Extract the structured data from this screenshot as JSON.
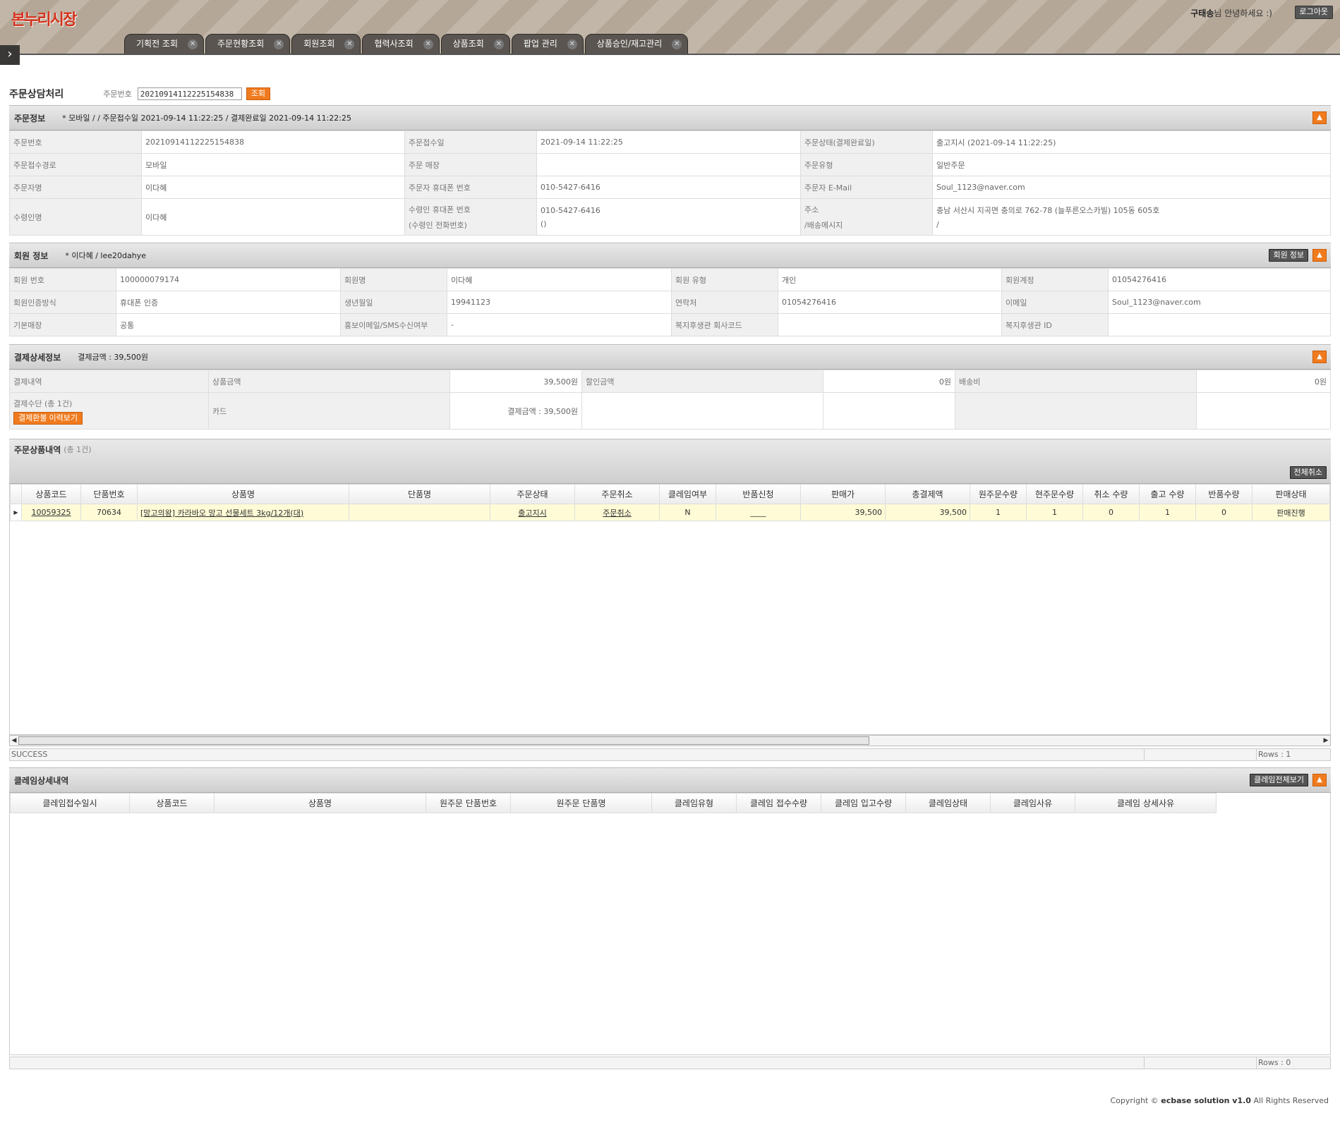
{
  "header": {
    "logo": "본누리시장",
    "user": "구태송",
    "greet_suffix": "님 안녕하세요 :)",
    "logout": "로그아웃"
  },
  "tabs": [
    {
      "label": "기획전 조회"
    },
    {
      "label": "주문현황조회"
    },
    {
      "label": "회원조회"
    },
    {
      "label": "협력사조회"
    },
    {
      "label": "상품조회"
    },
    {
      "label": "팝업 관리"
    },
    {
      "label": "상품승인/재고관리"
    }
  ],
  "search": {
    "title": "주문상담처리",
    "label": "주문번호",
    "value": "20210914112225154838",
    "button": "조회"
  },
  "order": {
    "title": "주문정보",
    "summary": "* 모바일 / / 주문접수일 2021-09-14 11:22:25 / 결제완료일 2021-09-14 11:22:25",
    "rows": [
      [
        [
          "주문번호",
          "20210914112225154838"
        ],
        [
          "주문접수일",
          "2021-09-14 11:22:25"
        ],
        [
          "주문상태(결제완료일)",
          "출고지시 (2021-09-14 11:22:25)"
        ]
      ],
      [
        [
          "주문접수경로",
          "모바일"
        ],
        [
          "주문 매장",
          ""
        ],
        [
          "주문유형",
          "일반주문"
        ]
      ],
      [
        [
          "주문자명",
          "이다혜"
        ],
        [
          "주문자 휴대폰 번호",
          "010-5427-6416"
        ],
        [
          "주문자 E-Mail",
          "Soul_1123@naver.com"
        ]
      ]
    ],
    "recv": {
      "k1": "수령인명",
      "v1": "이다혜",
      "k2a": "수령인 휴대폰 번호",
      "k2b": "(수령인 전화번호)",
      "v2a": "010-5427-6416",
      "v2b": "()",
      "k3a": "주소",
      "k3b": "/배송메시지",
      "v3a": "충남 서산시 지곡면 충의로 762-78 (늘푸른오스카빌) 105동 605호",
      "v3b": "/"
    }
  },
  "member": {
    "title": "회원 정보",
    "summary": "* 이다혜 / lee20dahye",
    "button": "회원 정보",
    "rows": [
      [
        [
          "회원 번호",
          "100000079174"
        ],
        [
          "회원명",
          "이다혜"
        ],
        [
          "회원 유형",
          "개인"
        ],
        [
          "회원계정",
          "01054276416"
        ]
      ],
      [
        [
          "회원인증방식",
          "휴대폰 인증"
        ],
        [
          "생년월일",
          "19941123"
        ],
        [
          "연락처",
          "01054276416"
        ],
        [
          "이메일",
          "Soul_1123@naver.com"
        ]
      ],
      [
        [
          "기본매장",
          "공통"
        ],
        [
          "홍보이메일/SMS수신여부",
          "-"
        ],
        [
          "복지후생관 회사코드",
          ""
        ],
        [
          "복지후생관 ID",
          ""
        ]
      ]
    ]
  },
  "payment": {
    "title": "결제상세정보",
    "summary": "결제금액 : 39,500원",
    "r1": {
      "k0": "결제내역",
      "k1": "상품금액",
      "v1": "39,500원",
      "k2": "할인금액",
      "v2": "0원",
      "k3": "배송비",
      "v3": "0원"
    },
    "r2": {
      "k0": "결제수단 (총 1건)",
      "btn": "결제환불 이력보기",
      "k1": "카드",
      "v1": "결제금액 : 39,500원"
    }
  },
  "items": {
    "title": "주문상품내역",
    "count": "(총 1건)",
    "cancel_all": "전체취소",
    "columns": [
      "상품코드",
      "단품번호",
      "상품명",
      "단품명",
      "주문상태",
      "주문취소",
      "클레임여부",
      "반품신청",
      "판매가",
      "총결제액",
      "원주문수량",
      "현주문수량",
      "취소 수량",
      "출고 수량",
      "반품수량",
      "판매상태"
    ],
    "row": {
      "code": "10059325",
      "sku": "70634",
      "name": "[망고의왕] 카라바오 망고 선물세트 3kg/12개(대)",
      "option": "",
      "status": "출고지시",
      "cancel": "주문취소",
      "claim": "N",
      "return": "____",
      "price": "39,500",
      "total": "39,500",
      "orig_qty": "1",
      "cur_qty": "1",
      "cancel_qty": "0",
      "ship_qty": "1",
      "return_qty": "0",
      "sale_status": "판매진행"
    },
    "status_text": "SUCCESS",
    "rows_text": "Rows : 1"
  },
  "claims": {
    "title": "클레임상세내역",
    "button": "클레임전체보기",
    "columns": [
      "클레임접수일시",
      "상품코드",
      "상품명",
      "원주문 단품번호",
      "원주문 단품명",
      "클레임유형",
      "클레임 접수수량",
      "클레임 입고수량",
      "클레임상태",
      "클레임사유",
      "클레임 상세사유"
    ],
    "rows_text": "Rows : 0"
  },
  "footer": {
    "pre": "Copyright ©",
    "brand": "ecbase solution v1.0",
    "post": "All Rights Reserved"
  }
}
